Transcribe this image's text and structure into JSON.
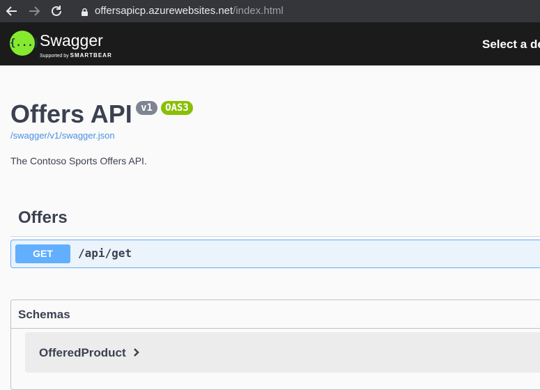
{
  "browser": {
    "url_host": "offersapicp.azurewebsites.net",
    "url_path": "/index.html"
  },
  "topbar": {
    "logo_glyph": "{...}",
    "logo_name": "Swagger",
    "logo_supported_by": "Supported by",
    "logo_brand": "SMARTBEAR",
    "select_definition": "Select a de"
  },
  "info": {
    "title": "Offers API",
    "version_badge": "v1",
    "spec_badge": "OAS3",
    "spec_link": "/swagger/v1/swagger.json",
    "description": "The Contoso Sports Offers API."
  },
  "tag": {
    "name": "Offers",
    "operations": [
      {
        "method": "GET",
        "path": "/api/get"
      }
    ]
  },
  "schemas": {
    "title": "Schemas",
    "models": [
      {
        "name": "OfferedProduct"
      }
    ]
  },
  "colors": {
    "get_accent": "#61affe",
    "swagger_green": "#85ea2d",
    "oas_badge": "#89bf04",
    "version_badge": "#7d8492",
    "link": "#4990e2"
  },
  "icons": [
    "back-arrow-icon",
    "forward-arrow-icon",
    "reload-icon",
    "lock-icon",
    "chevron-right-icon"
  ]
}
